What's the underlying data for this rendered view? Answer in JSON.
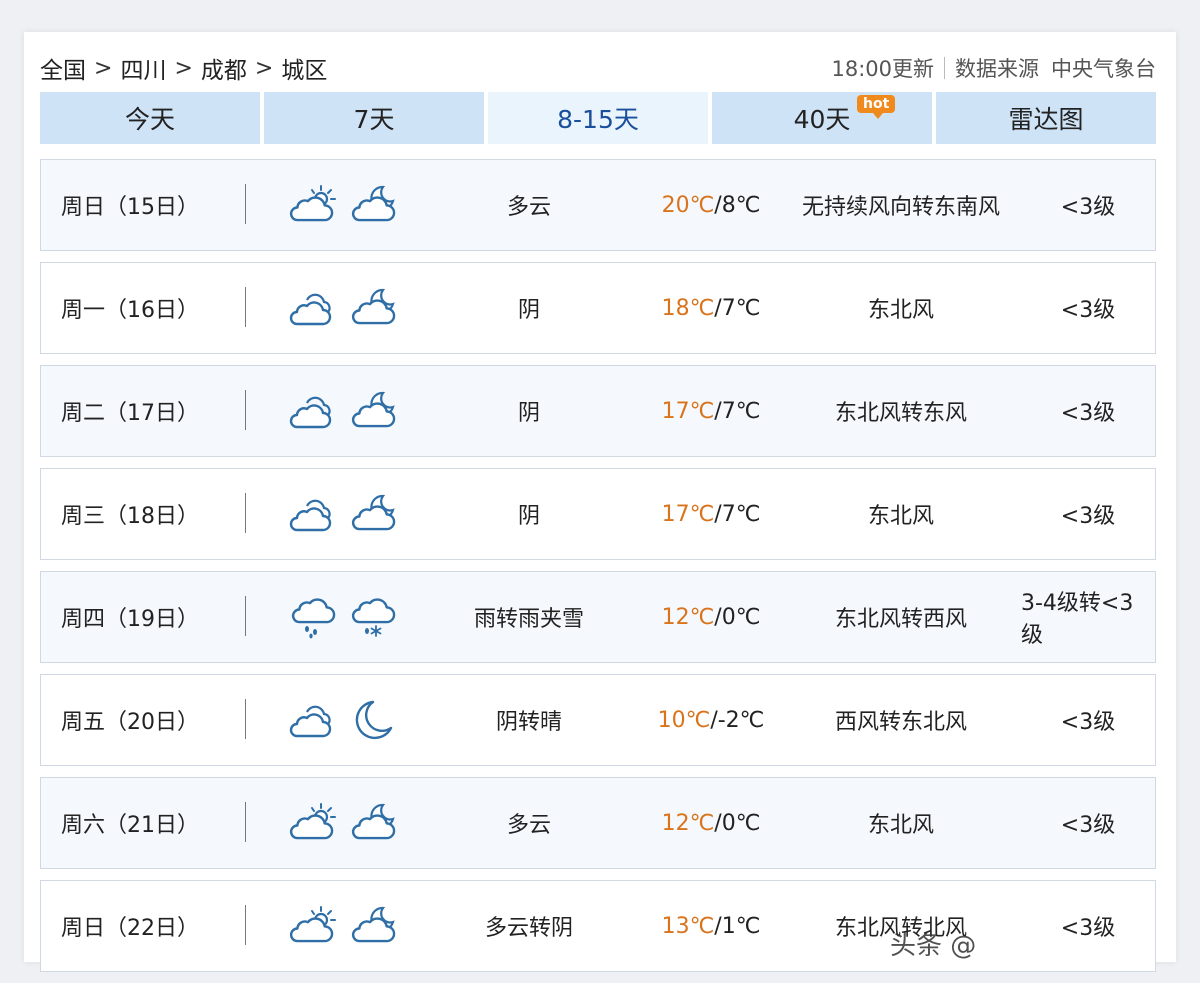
{
  "breadcrumb": [
    "全国",
    "四川",
    "成都",
    "城区"
  ],
  "breadcrumb_separator": ">",
  "update_time": "18:00更新",
  "source_label": "数据来源",
  "source_name": "中央气象台",
  "tabs": [
    {
      "label": "今天"
    },
    {
      "label": "7天"
    },
    {
      "label": "8-15天",
      "active": true
    },
    {
      "label": "40天",
      "badge": "hot"
    },
    {
      "label": "雷达图"
    }
  ],
  "forecast": [
    {
      "date": "周日（15日）",
      "day_icon": "partly-cloudy-day-icon",
      "night_icon": "partly-cloudy-night-icon",
      "desc": "多云",
      "high": "20℃",
      "low": "/8℃",
      "wind": "无持续风向转东南风",
      "level": "<3级"
    },
    {
      "date": "周一（16日）",
      "day_icon": "overcast-icon",
      "night_icon": "partly-cloudy-night-icon",
      "desc": "阴",
      "high": "18℃",
      "low": "/7℃",
      "wind": "东北风",
      "level": "<3级"
    },
    {
      "date": "周二（17日）",
      "day_icon": "overcast-icon",
      "night_icon": "partly-cloudy-night-icon",
      "desc": "阴",
      "high": "17℃",
      "low": "/7℃",
      "wind": "东北风转东风",
      "level": "<3级"
    },
    {
      "date": "周三（18日）",
      "day_icon": "overcast-icon",
      "night_icon": "partly-cloudy-night-icon",
      "desc": "阴",
      "high": "17℃",
      "low": "/7℃",
      "wind": "东北风",
      "level": "<3级"
    },
    {
      "date": "周四（19日）",
      "day_icon": "rain-icon",
      "night_icon": "sleet-icon",
      "desc": "雨转雨夹雪",
      "high": "12℃",
      "low": "/0℃",
      "wind": "东北风转西风",
      "level": "3-4级转<3级"
    },
    {
      "date": "周五（20日）",
      "day_icon": "overcast-icon",
      "night_icon": "crescent-moon-icon",
      "desc": "阴转晴",
      "high": "10℃",
      "low": "/-2℃",
      "wind": "西风转东北风",
      "level": "<3级"
    },
    {
      "date": "周六（21日）",
      "day_icon": "partly-cloudy-day-icon",
      "night_icon": "partly-cloudy-night-icon",
      "desc": "多云",
      "high": "12℃",
      "low": "/0℃",
      "wind": "东北风",
      "level": "<3级"
    },
    {
      "date": "周日（22日）",
      "day_icon": "partly-cloudy-day-icon",
      "night_icon": "partly-cloudy-night-icon",
      "desc": "多云转阴",
      "high": "13℃",
      "low": "/1℃",
      "wind": "东北风转北风",
      "level": "<3级"
    }
  ],
  "watermark": "头条 @",
  "colors": {
    "accent": "#1a4f9c",
    "tab_bg": "#cfe3f7",
    "high_temp": "#d9741c",
    "icon": "#2f6ea6"
  }
}
